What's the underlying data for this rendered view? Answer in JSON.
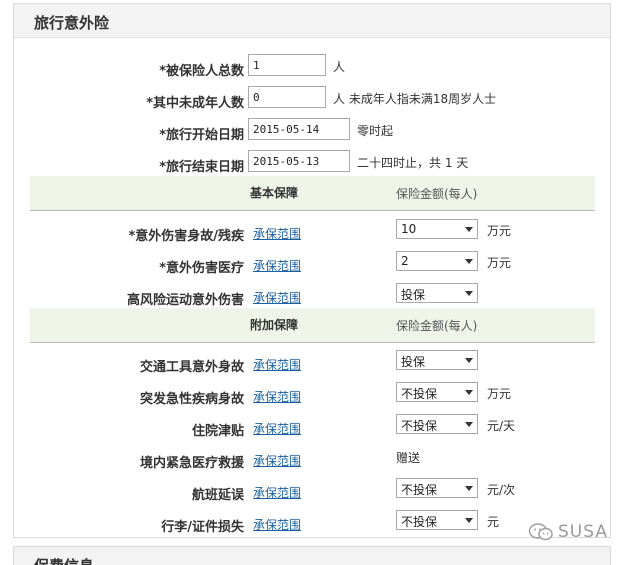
{
  "panel": {
    "title": "旅行意外险"
  },
  "footer_panel": {
    "title": "保费信息"
  },
  "fields": {
    "insured_total": {
      "label": "*被保险人总数",
      "value": "1",
      "unit": "人"
    },
    "minors": {
      "label": "*其中未成年人数",
      "value": "0",
      "unit": "人  未成年人指未满18周岁人士"
    },
    "start_date": {
      "label": "*旅行开始日期",
      "value": "2015-05-14",
      "unit": "零时起"
    },
    "end_date": {
      "label": "*旅行结束日期",
      "value": "2015-05-13",
      "unit": "二十四时止，共 1  天"
    }
  },
  "basic": {
    "title": "基本保障",
    "amount_header": "保险金额(每人)",
    "items": [
      {
        "label": "*意外伤害身故/残疾",
        "link": "承保范围",
        "selected": "10",
        "unit": "万元"
      },
      {
        "label": "*意外伤害医疗",
        "link": "承保范围",
        "selected": "2",
        "unit": "万元"
      },
      {
        "label": "高风险运动意外伤害",
        "link": "承保范围",
        "selected": "投保",
        "unit": ""
      }
    ]
  },
  "additional": {
    "title": "附加保障",
    "amount_header": "保险金额(每人)",
    "items": [
      {
        "label": "交通工具意外身故",
        "link": "承保范围",
        "selected": "投保",
        "unit": ""
      },
      {
        "label": "突发急性疾病身故",
        "link": "承保范围",
        "selected": "不投保",
        "unit": "万元"
      },
      {
        "label": "住院津贴",
        "link": "承保范围",
        "selected": "不投保",
        "unit": "元/天"
      },
      {
        "label": "境内紧急医疗救援",
        "link": "承保范围",
        "gift": "赠送"
      },
      {
        "label": "航班延误",
        "link": "承保范围",
        "selected": "不投保",
        "unit": "元/次"
      },
      {
        "label": "行李/证件损失",
        "link": "承保范围",
        "selected": "不投保",
        "unit": "元"
      }
    ]
  },
  "watermark": {
    "text": "SUSA",
    "icon": "wechat-icon"
  }
}
